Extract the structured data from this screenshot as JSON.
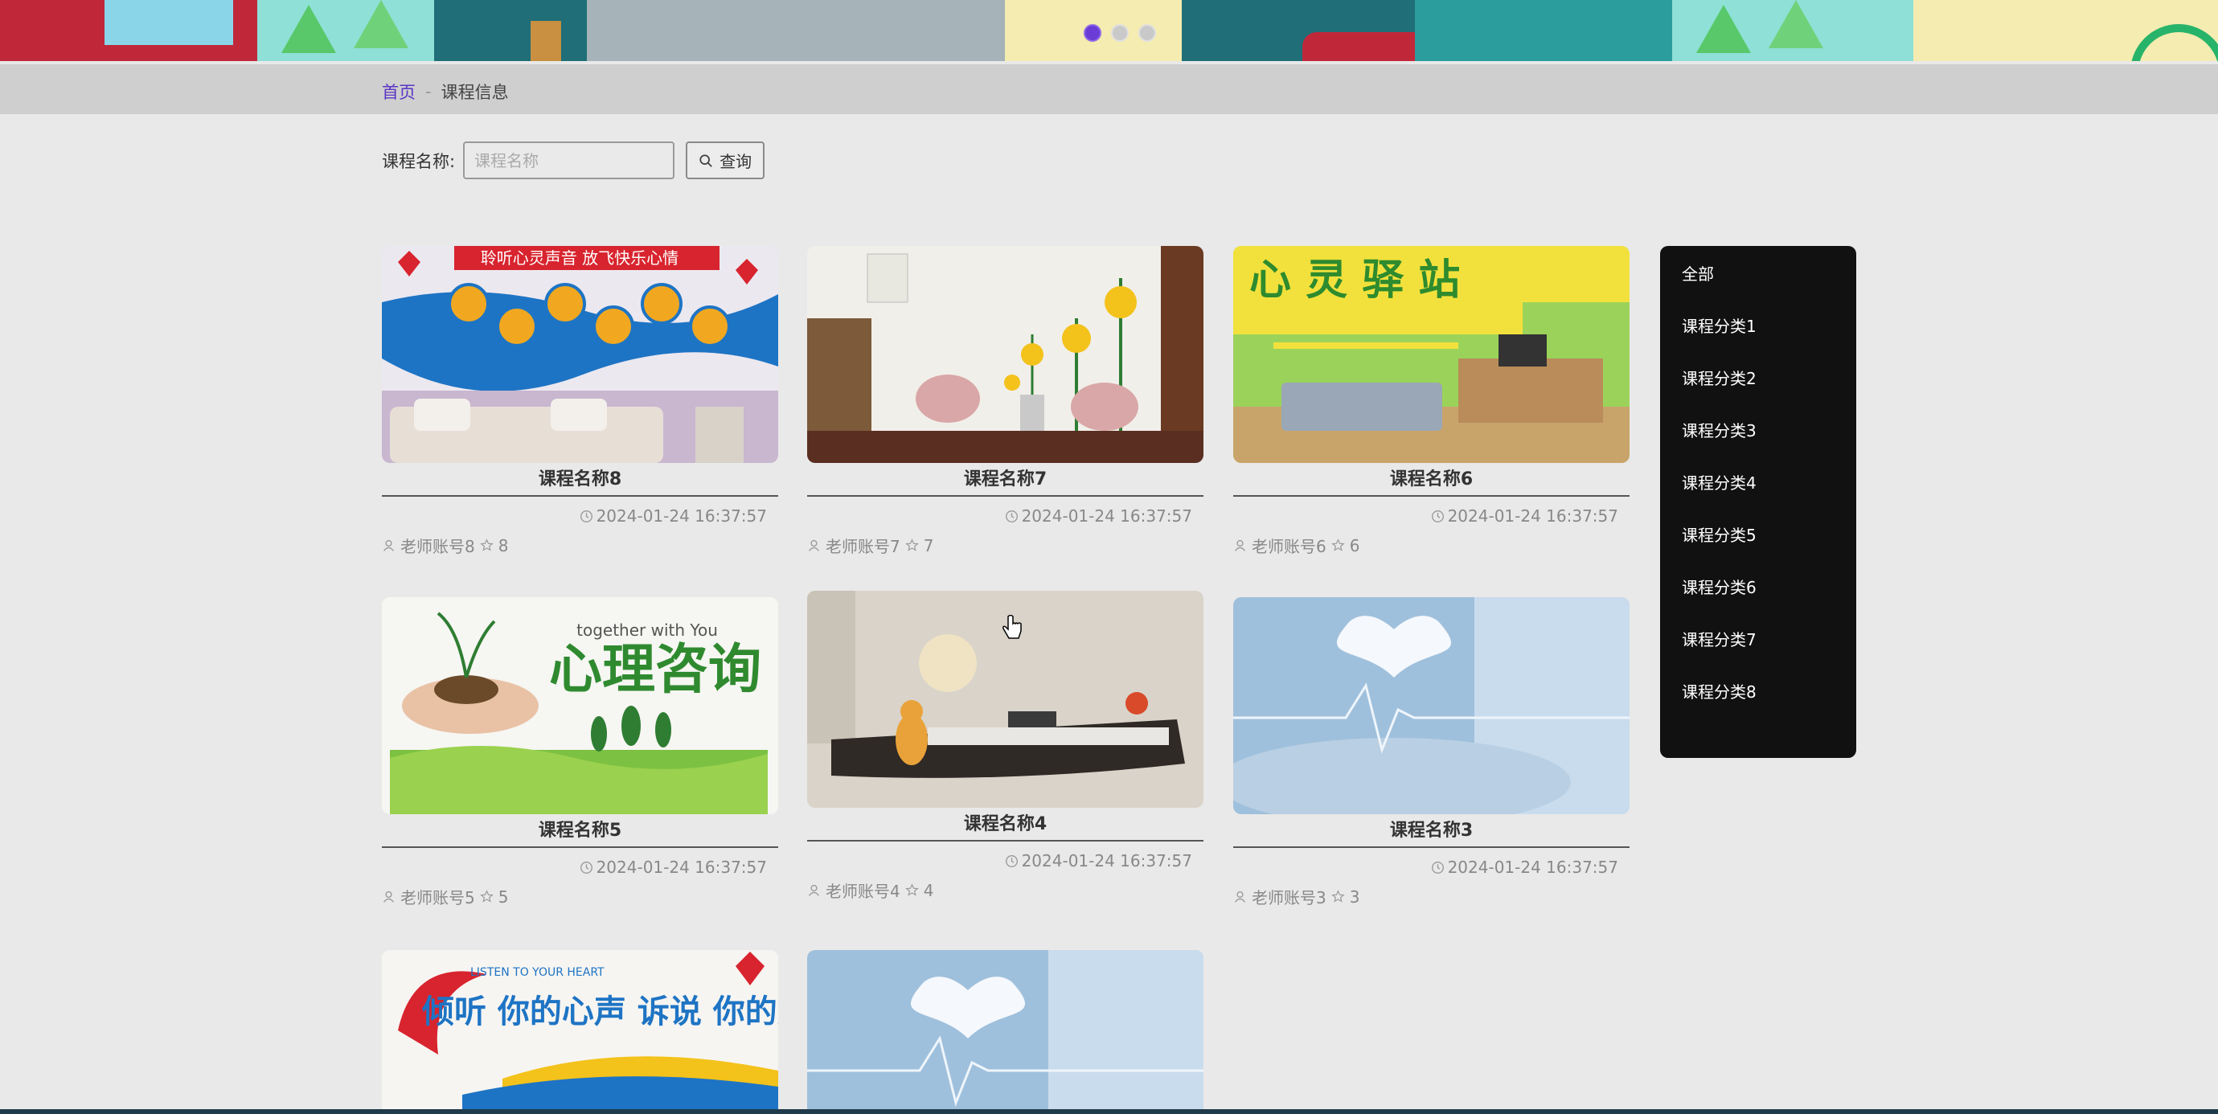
{
  "banner": {
    "slides": 3,
    "active_slide": 1
  },
  "breadcrumb": {
    "home": "首页",
    "separator": "-",
    "current": "课程信息"
  },
  "search": {
    "label": "课程名称:",
    "placeholder": "课程名称",
    "value": "",
    "button_label": "查询"
  },
  "courses": [
    {
      "title": "课程名称8",
      "time": "2024-01-24 16:37:57",
      "teacher": "老师账号8",
      "likes": "8",
      "image_text": "聆听心灵声音 放飞快乐心情"
    },
    {
      "title": "课程名称7",
      "time": "2024-01-24 16:37:57",
      "teacher": "老师账号7",
      "likes": "7",
      "image_text": ""
    },
    {
      "title": "课程名称6",
      "time": "2024-01-24 16:37:57",
      "teacher": "老师账号6",
      "likes": "6",
      "image_text": "心 灵 驿 站"
    },
    {
      "title": "课程名称5",
      "time": "2024-01-24 16:37:57",
      "teacher": "老师账号5",
      "likes": "5",
      "image_text": "心理咨询",
      "image_subtext": "together with You"
    },
    {
      "title": "课程名称4",
      "time": "2024-01-24 16:37:57",
      "teacher": "老师账号4",
      "likes": "4",
      "image_text": ""
    },
    {
      "title": "课程名称3",
      "time": "2024-01-24 16:37:57",
      "teacher": "老师账号3",
      "likes": "3",
      "image_text": ""
    },
    {
      "title": "",
      "time": "",
      "teacher": "",
      "likes": "",
      "image_text": "倾听 你的心声 诉说 你的烦恼",
      "image_subtext": "LISTEN TO YOUR HEART"
    },
    {
      "title": "",
      "time": "",
      "teacher": "",
      "likes": "",
      "image_text": ""
    }
  ],
  "categories": [
    "全部",
    "课程分类1",
    "课程分类2",
    "课程分类3",
    "课程分类4",
    "课程分类5",
    "课程分类6",
    "课程分类7",
    "课程分类8"
  ],
  "colors": {
    "accent": "#5a34c4",
    "sidebar_bg": "#111111",
    "page_bg": "#e9e9e9"
  },
  "icons": {
    "time": "clock-icon",
    "teacher": "user-icon",
    "likes": "star-icon",
    "search": "search-icon"
  }
}
